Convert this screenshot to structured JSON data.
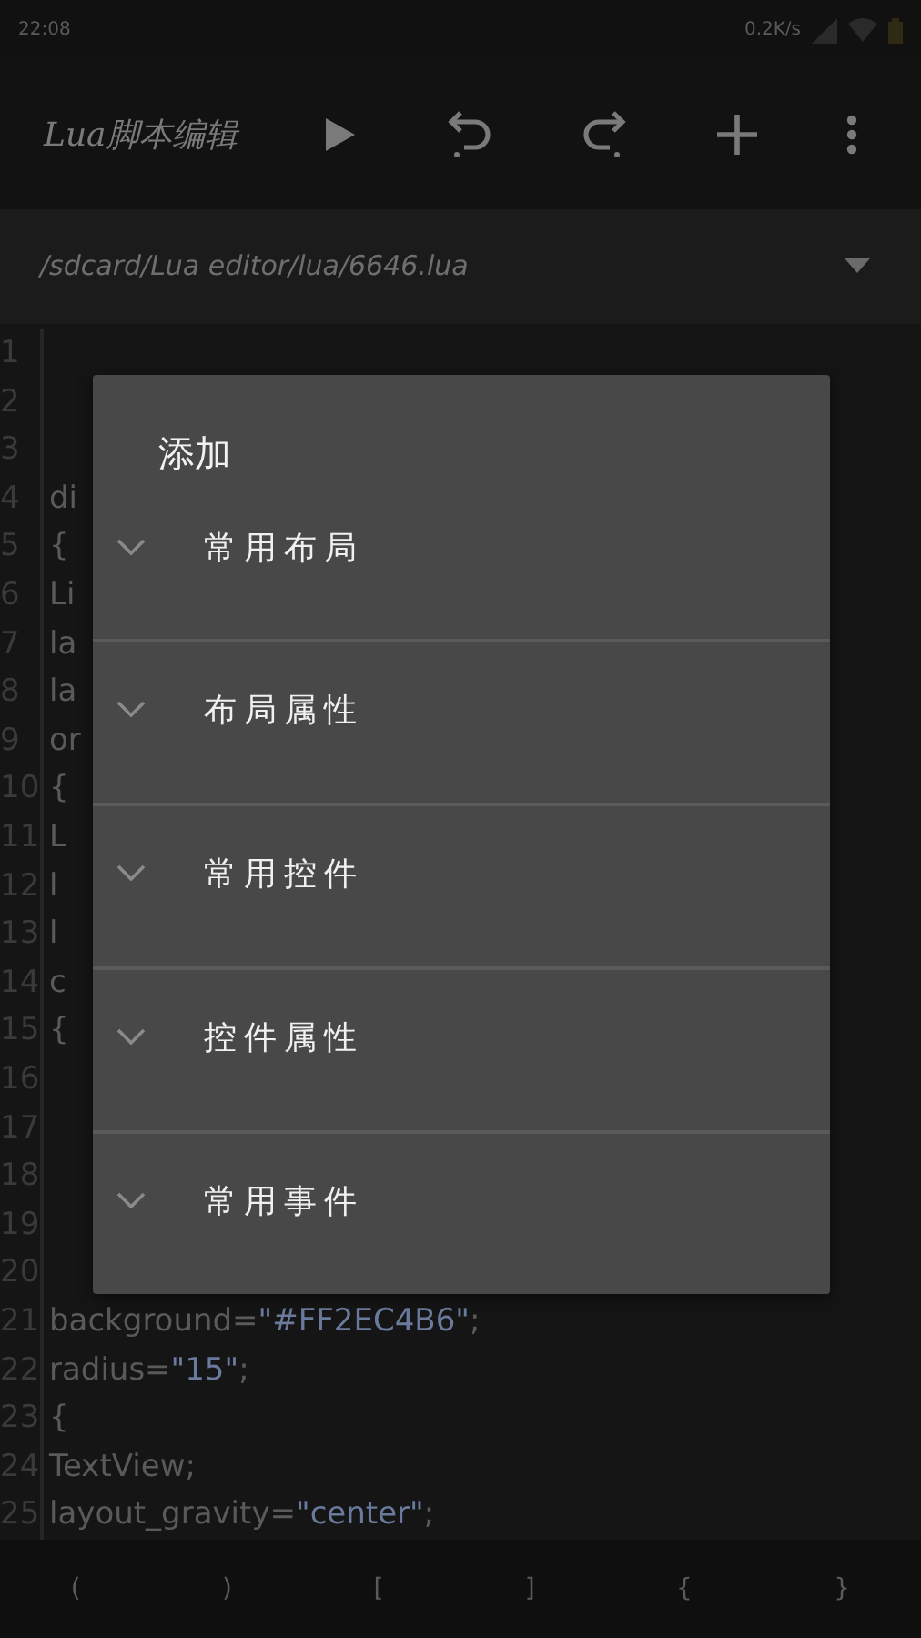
{
  "status_bar": {
    "time": "22:08",
    "speed": "0.2K/s"
  },
  "toolbar": {
    "title": "Lua脚本编辑",
    "actions": [
      {
        "kind": "run"
      },
      {
        "kind": "undo"
      },
      {
        "kind": "redo"
      },
      {
        "kind": "add"
      },
      {
        "kind": "more"
      }
    ]
  },
  "path_bar": {
    "path": "/sdcard/Lua editor/lua/6646.lua"
  },
  "editor": {
    "lines": [
      {
        "number": "1"
      },
      {
        "number": "2"
      },
      {
        "number": "3"
      },
      {
        "number": "4",
        "segments": [
          {
            "text": "di",
            "kind": "plain"
          }
        ]
      },
      {
        "number": "5",
        "segments": [
          {
            "text": "{",
            "kind": "plain"
          }
        ]
      },
      {
        "number": "6",
        "segments": [
          {
            "text": "Li",
            "kind": "plain"
          }
        ]
      },
      {
        "number": "7",
        "segments": [
          {
            "text": "la",
            "kind": "plain"
          }
        ]
      },
      {
        "number": "8",
        "segments": [
          {
            "text": "la",
            "kind": "plain"
          }
        ]
      },
      {
        "number": "9",
        "segments": [
          {
            "text": "or",
            "kind": "plain"
          }
        ]
      },
      {
        "number": "10",
        "segments": [
          {
            "text": "{",
            "kind": "plain"
          }
        ]
      },
      {
        "number": "11",
        "segments": [
          {
            "text": "L",
            "kind": "plain"
          }
        ]
      },
      {
        "number": "12",
        "segments": [
          {
            "text": "l",
            "kind": "plain"
          }
        ]
      },
      {
        "number": "13",
        "segments": [
          {
            "text": "l",
            "kind": "plain"
          }
        ]
      },
      {
        "number": "14",
        "segments": [
          {
            "text": "c",
            "kind": "plain"
          }
        ]
      },
      {
        "number": "15",
        "segments": [
          {
            "text": "{",
            "kind": "plain"
          }
        ]
      },
      {
        "number": "16"
      },
      {
        "number": "17"
      },
      {
        "number": "18"
      },
      {
        "number": "19"
      },
      {
        "number": "20"
      },
      {
        "number": "21",
        "segments": [
          {
            "text": "background=",
            "kind": "plain"
          },
          {
            "text": "\"#FF2EC4B6\"",
            "kind": "string"
          },
          {
            "text": ";",
            "kind": "plain"
          }
        ]
      },
      {
        "number": "22",
        "segments": [
          {
            "text": "radius=",
            "kind": "plain"
          },
          {
            "text": "\"15\"",
            "kind": "string"
          },
          {
            "text": ";",
            "kind": "plain"
          }
        ]
      },
      {
        "number": "23",
        "segments": [
          {
            "text": "{",
            "kind": "plain"
          }
        ]
      },
      {
        "number": "24",
        "segments": [
          {
            "text": "TextView;",
            "kind": "plain"
          }
        ]
      },
      {
        "number": "25",
        "segments": [
          {
            "text": "layout_gravity=",
            "kind": "plain"
          },
          {
            "text": "\"center\"",
            "kind": "string"
          },
          {
            "text": ";",
            "kind": "plain"
          }
        ]
      }
    ]
  },
  "dialog": {
    "title": "添加",
    "items": [
      {
        "label": "常用布局",
        "expanded": false
      },
      {
        "label": "布局属性",
        "expanded": false
      },
      {
        "label": "常用控件",
        "expanded": false
      },
      {
        "label": "控件属性",
        "expanded": false
      },
      {
        "label": "常用事件",
        "expanded": false
      }
    ]
  },
  "symbol_bar": {
    "keys": [
      "(",
      ")",
      "[",
      "]",
      "{",
      "}"
    ]
  }
}
